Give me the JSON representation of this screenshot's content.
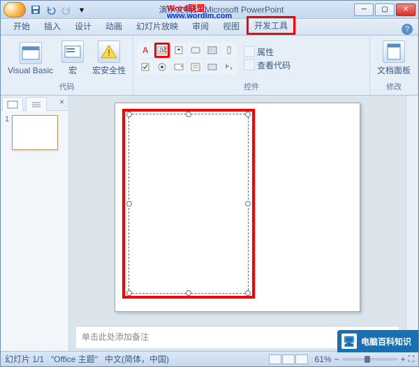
{
  "title": {
    "doc": "演示文稿1",
    "app": "Microsoft PowerPoint",
    "overlay_main": "Word联盟",
    "overlay_sub": "www.wordlm.com"
  },
  "qat": {
    "save": "save-icon",
    "undo": "undo-icon",
    "redo": "redo-icon",
    "more": "▾"
  },
  "tabs": {
    "items": [
      {
        "label": "开始"
      },
      {
        "label": "插入"
      },
      {
        "label": "设计"
      },
      {
        "label": "动画"
      },
      {
        "label": "幻灯片放映"
      },
      {
        "label": "审阅"
      },
      {
        "label": "视图"
      },
      {
        "label": "开发工具"
      }
    ]
  },
  "ribbon": {
    "group_code": {
      "label": "代码",
      "vb": "Visual Basic",
      "macro": "宏",
      "security": "宏安全性"
    },
    "group_controls": {
      "label": "控件",
      "properties": "属性",
      "view_code": "查看代码"
    },
    "group_modify": {
      "label": "修改",
      "panel": "文档面板"
    }
  },
  "pane": {
    "slide_num": "1"
  },
  "notes": {
    "placeholder": "单击此处添加备注"
  },
  "status": {
    "slide": "幻灯片 1/1",
    "theme": "\"Office 主题\"",
    "lang": "中文(简体，中国)",
    "zoom": "61%"
  },
  "watermark": {
    "text": "电脑百科知识"
  }
}
